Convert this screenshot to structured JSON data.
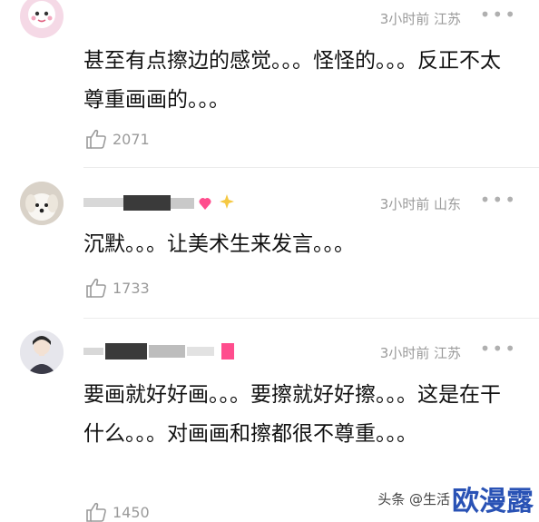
{
  "comments": [
    {
      "time_location": "3小时前 江苏",
      "text": "甚至有点擦边的感觉。。。怪怪的。。。反正不太尊重画画的。。。",
      "likes": "2071",
      "more_icon": "more-dots-icon"
    },
    {
      "time_location": "3小时前 山东",
      "text": "沉默。。。让美术生来发言。。。",
      "likes": "1733",
      "more_icon": "more-dots-icon"
    },
    {
      "time_location": "3小时前 江苏",
      "text": "要画就好好画。。。要擦就好好擦。。。这是在干什么。。。对画画和擦都很不尊重。。。",
      "likes": "1450",
      "more_icon": "more-dots-icon"
    }
  ],
  "watermark": {
    "prefix": "头条 @生活",
    "brand": "欧漫露"
  },
  "colors": {
    "meta_gray": "#9a9a9a",
    "brand_blue": "#2952b5"
  }
}
